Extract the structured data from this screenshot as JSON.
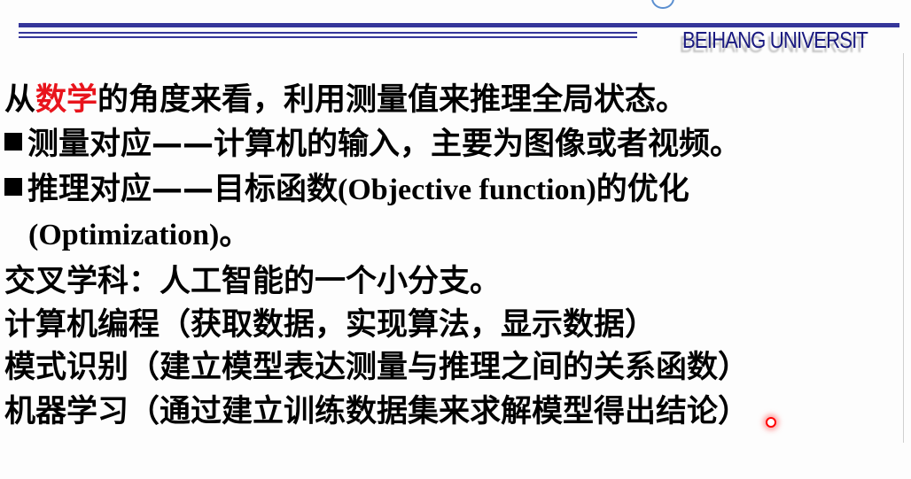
{
  "header": {
    "brand": "BEIHANG UNIVERSIT",
    "accent_color": "#35369a"
  },
  "lines": [
    {
      "pre": "从",
      "highlight": "数学",
      "post": "的角度来看，利用测量值来推理全局状态。",
      "highlight_color": "#e8141c"
    },
    {
      "bullet": true,
      "text": "测量对应——计算机的输入，主要为图像或者视频。"
    },
    {
      "bullet": true,
      "text_a": "推理对应——目标函数",
      "latin": "(Objective function)",
      "text_b": "的优化"
    },
    {
      "latin": "(Optimization)",
      "text_b": "。"
    },
    {
      "text": "交叉学科：人工智能的一个小分支。"
    },
    {
      "text": "计算机编程（获取数据，实现算法，显示数据）"
    },
    {
      "text": "模式识别（建立模型表达测量与推理之间的关系函数）"
    },
    {
      "text": "机器学习（通过建立训练数据集来求解模型得出结论）"
    }
  ]
}
